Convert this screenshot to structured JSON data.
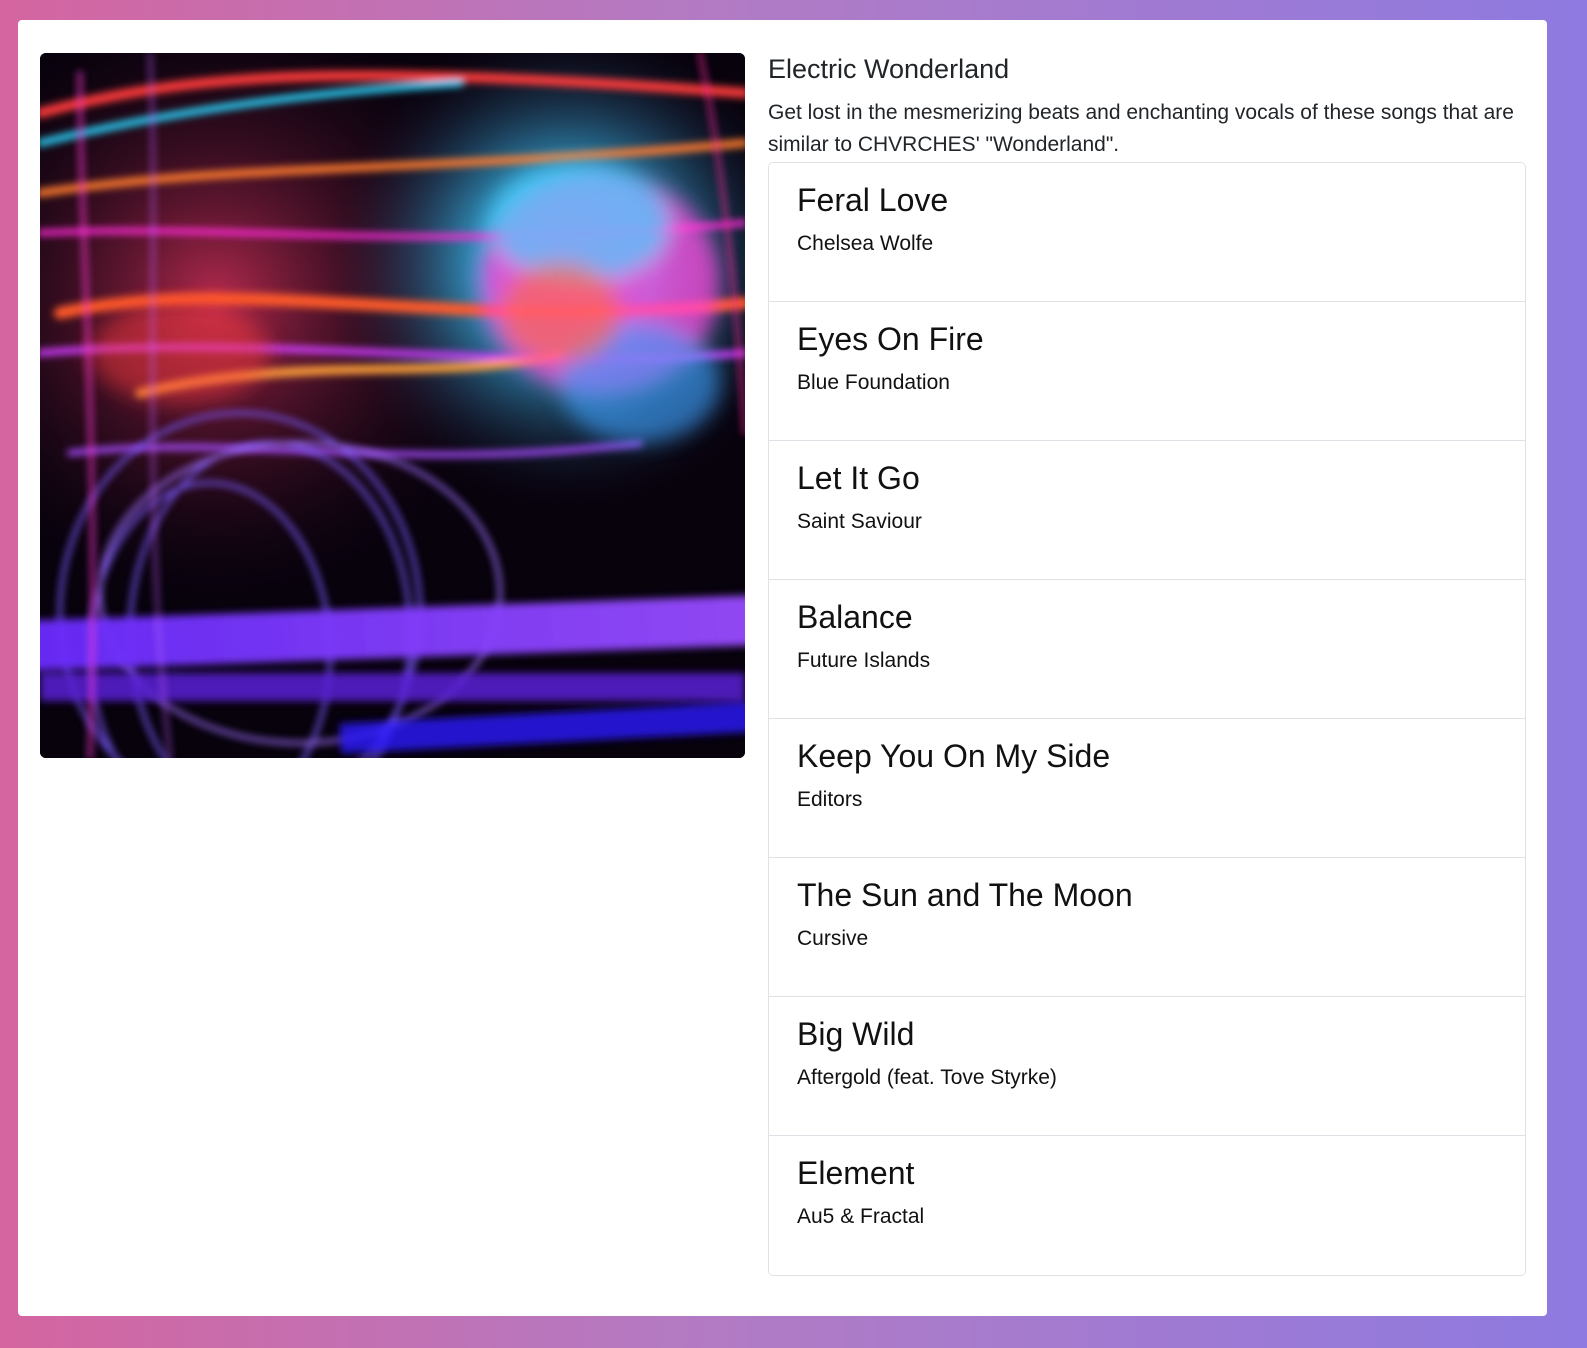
{
  "playlist": {
    "title": "Electric Wonderland",
    "description": "Get lost in the mesmerizing beats and enchanting vocals of these songs that are similar to CHVRCHES' \"Wonderland\".",
    "cover_image": "abstract neon light-painting artwork"
  },
  "tracks": [
    {
      "title": "Feral Love",
      "artist": "Chelsea Wolfe"
    },
    {
      "title": "Eyes On Fire",
      "artist": "Blue Foundation"
    },
    {
      "title": "Let It Go",
      "artist": "Saint Saviour"
    },
    {
      "title": "Balance",
      "artist": "Future Islands"
    },
    {
      "title": "Keep You On My Side",
      "artist": "Editors"
    },
    {
      "title": "The Sun and The Moon",
      "artist": "Cursive"
    },
    {
      "title": "Big Wild",
      "artist": "Aftergold (feat. Tove Styrke)"
    },
    {
      "title": "Element",
      "artist": "Au5 & Fractal"
    }
  ]
}
